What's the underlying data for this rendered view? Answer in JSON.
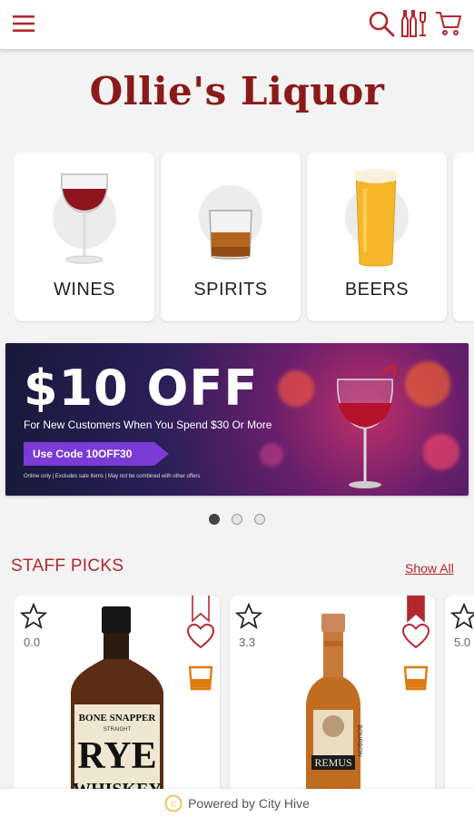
{
  "header": {
    "menu_icon": "hamburger-menu-icon",
    "search_icon": "search-icon",
    "filter_icon": "bottles-filter-icon",
    "cart_icon": "cart-icon",
    "brand_color": "#b3282d"
  },
  "logo": {
    "text": "Ollie's Liquor",
    "color": "#8b1a1a"
  },
  "categories": [
    {
      "label": "WINES",
      "icon": "wine-glass-icon"
    },
    {
      "label": "SPIRITS",
      "icon": "whiskey-glass-icon"
    },
    {
      "label": "BEERS",
      "icon": "beer-glass-icon"
    }
  ],
  "banner": {
    "title": "$10 OFF",
    "subtitle": "For New Customers When You Spend $30 Or More",
    "code_label": "Use Code 10OFF30",
    "fine_print": "Online only | Excludes sale items | May not be combined with other offers"
  },
  "carousel": {
    "page_count": 3,
    "active_page": 1
  },
  "staff_picks": {
    "title": "STAFF PICKS",
    "show_all_label": "Show All",
    "products": [
      {
        "rating": "0.0",
        "bottle_label_top": "BONE SNAPPER",
        "bottle_label_mid": "STRAIGHT",
        "bottle_label_main": "RYE",
        "bottle_label_sub": "WHISKEY",
        "favorited": false,
        "bookmarked": false
      },
      {
        "rating": "3.3",
        "bottle_label_main": "REMUS",
        "bottle_label_side": "BOURBON",
        "favorited": false,
        "bookmarked": true
      },
      {
        "rating": "5.0"
      }
    ]
  },
  "footer": {
    "text": "Powered by City Hive",
    "icon": "city-hive-logo-icon"
  }
}
